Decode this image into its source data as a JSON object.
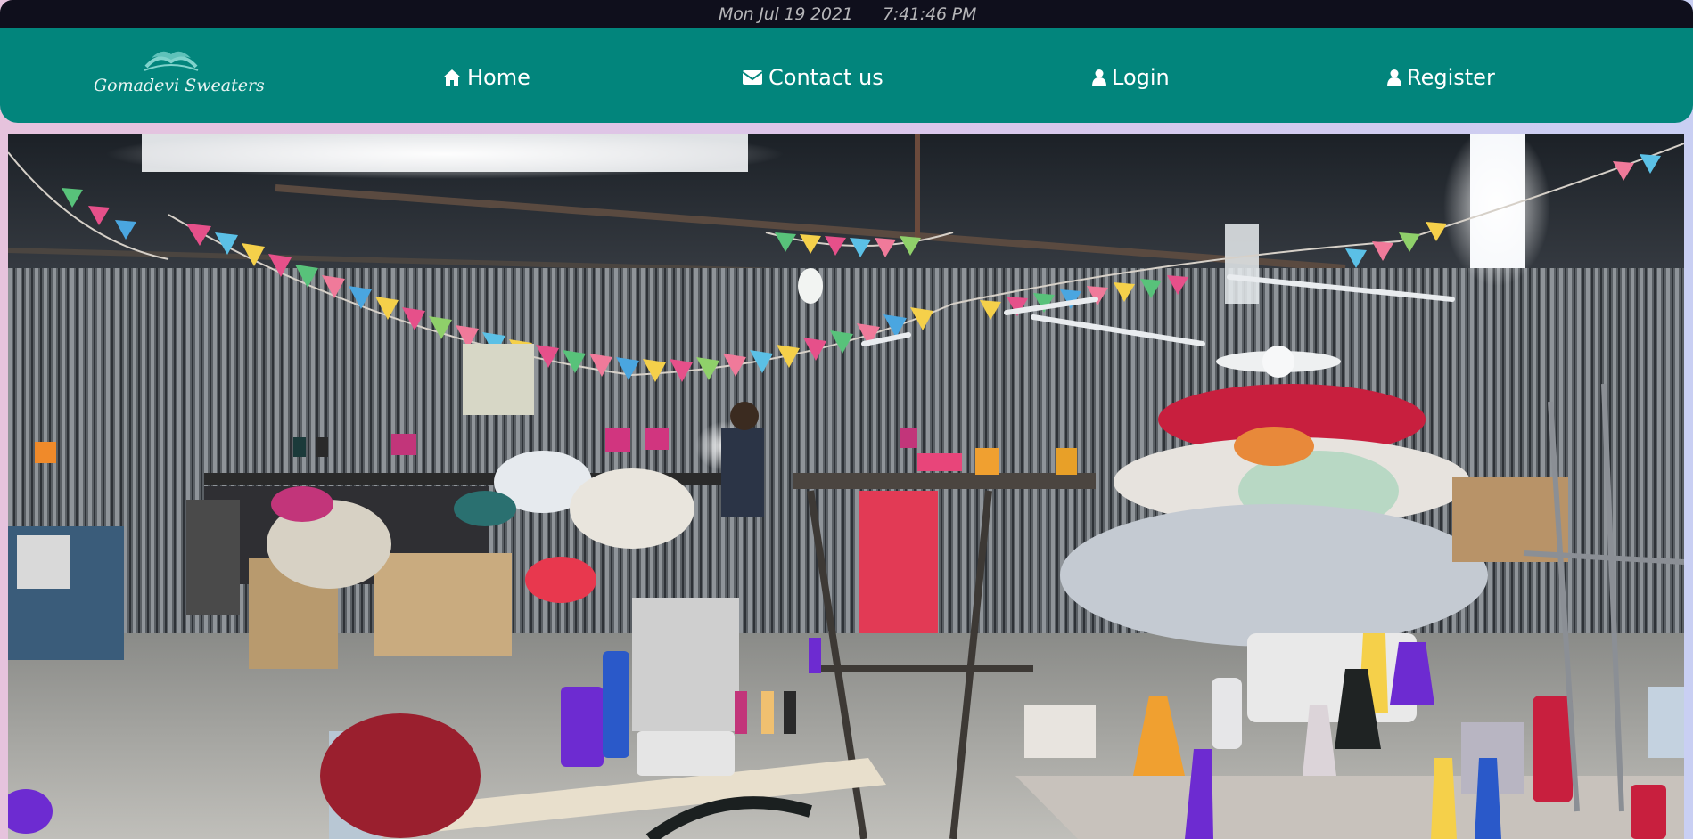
{
  "topbar": {
    "date": "Mon Jul 19 2021",
    "time": "7:41:46 PM"
  },
  "brand": {
    "name": "Gomadevi Sweaters",
    "logo_icon": "wave-icon",
    "color": "#02857c"
  },
  "nav": {
    "home": {
      "label": "Home",
      "icon": "home-icon"
    },
    "contact": {
      "label": "Contact us",
      "icon": "envelope-icon"
    },
    "login": {
      "label": "Login",
      "icon": "user-icon"
    },
    "register": {
      "label": "Register",
      "icon": "user-icon"
    }
  },
  "colors": {
    "topbar_bg": "#0f0f1c",
    "navbar_bg": "#02857c",
    "nav_text": "#ffffff"
  }
}
